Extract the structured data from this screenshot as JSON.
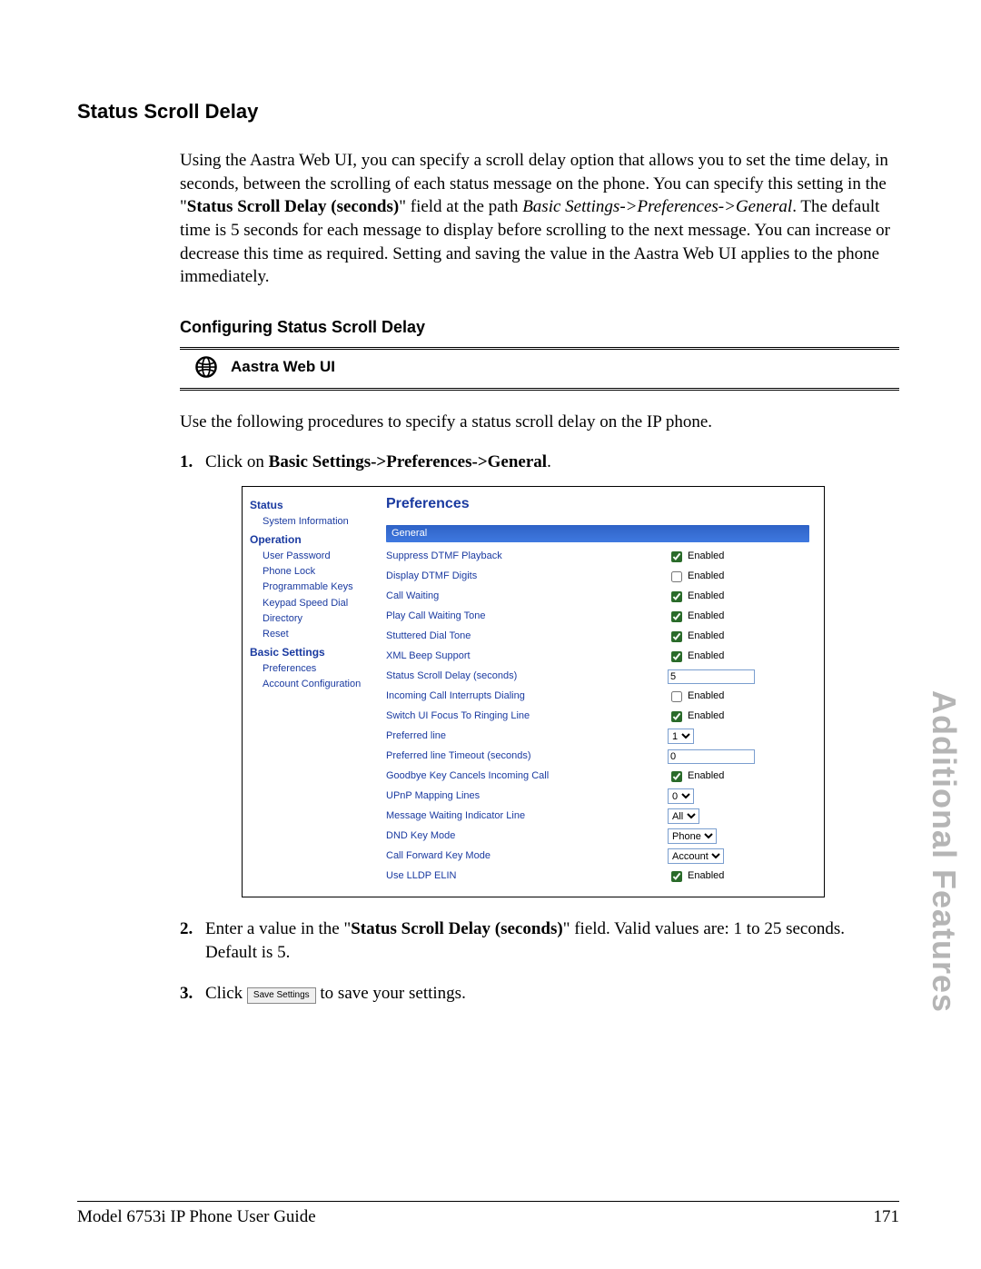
{
  "section_title": "Status Scroll Delay",
  "intro": {
    "p1a": "Using the Aastra Web UI, you can specify a scroll delay option that allows you to set the time delay, in seconds, between the scrolling of each status message on the phone. You can specify this setting in the \"",
    "p1b_bold": "Status Scroll Delay (seconds)",
    "p1c": "\" field at the path ",
    "p1d_italic": "Basic Settings->Preferences->General",
    "p1e": ". The default time is 5 seconds for each message to display before scrolling to the next message. You can increase or decrease this time as required. Setting and saving the value in the Aastra Web UI applies to the phone immediately."
  },
  "sub_title": "Configuring Status Scroll Delay",
  "webui_label": "Aastra Web UI",
  "intro_line": "Use the following procedures to specify a status scroll delay on the IP phone.",
  "steps": {
    "s1a": "Click on ",
    "s1b_bold": "Basic Settings->Preferences->General",
    "s1c": ".",
    "s2a": "Enter a value in the \"",
    "s2b_bold": "Status Scroll Delay (seconds)",
    "s2c": "\" field. Valid values are: 1 to 25 seconds. Default is 5.",
    "s3a": "Click ",
    "s3_btn": "Save Settings",
    "s3b": " to save your settings."
  },
  "shot": {
    "nav": {
      "status": "Status",
      "sys_info": "System Information",
      "operation": "Operation",
      "user_password": "User Password",
      "phone_lock": "Phone Lock",
      "prog_keys": "Programmable Keys",
      "keypad_speed": "Keypad Speed Dial",
      "directory": "Directory",
      "reset": "Reset",
      "basic_settings": "Basic Settings",
      "preferences": "Preferences",
      "account_config": "Account Configuration"
    },
    "title": "Preferences",
    "section": "General",
    "enabled_label": "Enabled",
    "rows": {
      "suppress_dtmf": "Suppress DTMF Playback",
      "display_dtmf": "Display DTMF Digits",
      "call_waiting": "Call Waiting",
      "play_cw_tone": "Play Call Waiting Tone",
      "stuttered": "Stuttered Dial Tone",
      "xml_beep": "XML Beep Support",
      "scroll_delay": "Status Scroll Delay (seconds)",
      "scroll_delay_val": "5",
      "incoming_interrupts": "Incoming Call Interrupts Dialing",
      "switch_focus": "Switch UI Focus To Ringing Line",
      "preferred_line": "Preferred line",
      "preferred_line_val": "1",
      "preferred_timeout": "Preferred line Timeout (seconds)",
      "preferred_timeout_val": "0",
      "goodbye_cancel": "Goodbye Key Cancels Incoming Call",
      "upnp": "UPnP Mapping Lines",
      "upnp_val": "0",
      "mwi": "Message Waiting Indicator Line",
      "mwi_val": "All",
      "dnd": "DND Key Mode",
      "dnd_val": "Phone",
      "cf": "Call Forward Key Mode",
      "cf_val": "Account",
      "lldp": "Use LLDP ELIN"
    }
  },
  "side_band": "Additional Features",
  "footer": {
    "left": "Model 6753i IP Phone User Guide",
    "right": "171"
  }
}
